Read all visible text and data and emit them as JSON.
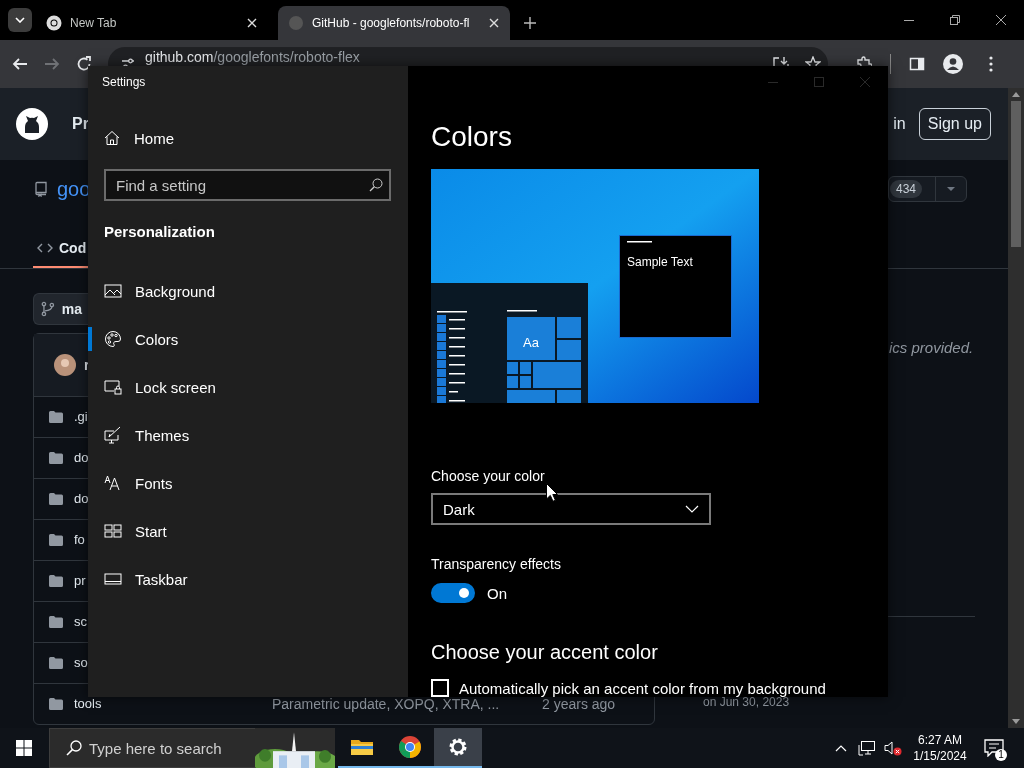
{
  "browser": {
    "tabs": [
      {
        "title": "New Tab",
        "selected": false
      },
      {
        "title": "GitHub - googlefonts/roboto-fl",
        "selected": true
      }
    ],
    "address": {
      "host": "github.com",
      "path": "/googlefonts/roboto-flex"
    }
  },
  "github": {
    "header": {
      "nav_item": "Pr",
      "sign_in": "in",
      "sign_up": "Sign up"
    },
    "repo": {
      "name": "goo",
      "count": "434"
    },
    "tabs": [
      {
        "label": "Cod",
        "selected": true
      }
    ],
    "branch": "ma",
    "commit_author": "r",
    "files": [
      {
        "name": ".gi"
      },
      {
        "name": "do"
      },
      {
        "name": "do"
      },
      {
        "name": "fo"
      },
      {
        "name": "pr"
      },
      {
        "name": "sc"
      },
      {
        "name": "so"
      },
      {
        "name": "tools",
        "message": "Parametric update, XOPQ, XTRA, ...",
        "age": "2 years ago"
      }
    ],
    "sidebar": {
      "about": "ics provided.",
      "release_date": "on Jun 30, 2023"
    }
  },
  "settings": {
    "title": "Settings",
    "home": "Home",
    "search": {
      "placeholder": "Find a setting"
    },
    "section": "Personalization",
    "nav": [
      {
        "label": "Background",
        "selected": false
      },
      {
        "label": "Colors",
        "selected": true
      },
      {
        "label": "Lock screen",
        "selected": false
      },
      {
        "label": "Themes",
        "selected": false
      },
      {
        "label": "Fonts",
        "selected": false
      },
      {
        "label": "Start",
        "selected": false
      },
      {
        "label": "Taskbar",
        "selected": false
      }
    ],
    "page": {
      "title": "Colors",
      "preview": {
        "sample_text": "Sample Text",
        "tile_text": "Aa"
      },
      "color_mode": {
        "label": "Choose your color",
        "value": "Dark"
      },
      "transparency": {
        "label": "Transparency effects",
        "on": true,
        "state_text": "On"
      },
      "accent_heading": "Choose your accent color",
      "auto_accent": {
        "label": "Automatically pick an accent color from my background",
        "checked": false
      }
    }
  },
  "taskbar": {
    "search": {
      "placeholder": "Type here to search"
    },
    "apps": [
      {
        "kind": "explorer",
        "active": false,
        "running": true
      },
      {
        "kind": "chrome",
        "active": false,
        "running": true
      },
      {
        "kind": "settings",
        "active": true,
        "running": true
      }
    ],
    "time": "6:27 AM",
    "date": "1/15/2024",
    "notifications": "1"
  }
}
